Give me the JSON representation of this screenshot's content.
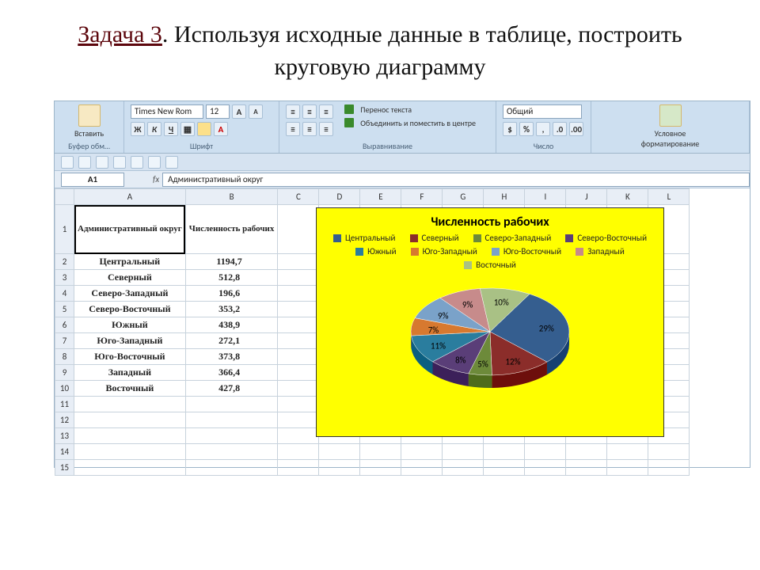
{
  "task": {
    "label": "Задача 3",
    "text": ". Используя исходные данные в таблице, построить круговую диаграмму"
  },
  "ribbon": {
    "paste": "Вставить",
    "g_clip": "Буфер обм…",
    "font_name": "Times New Rom",
    "font_size": "12",
    "bold": "Ж",
    "italic": "К",
    "underline": "Ч",
    "g_font": "Шрифт",
    "wrap": "Перенос текста",
    "merge": "Объединить и поместить в центре",
    "g_align": "Выравнивание",
    "num_fmt": "Общий",
    "g_num": "Число",
    "cond": "Условное форматирование",
    "g_styles": ""
  },
  "qat": {
    "buttons": 7
  },
  "formula_bar": {
    "name": "A1",
    "fx": "fx",
    "value": "Административный округ"
  },
  "grid": {
    "cols": [
      "A",
      "B",
      "C",
      "D",
      "E",
      "F",
      "G",
      "H",
      "I",
      "J",
      "K",
      "L"
    ],
    "rows": [
      "1",
      "2",
      "3",
      "4",
      "5",
      "6",
      "7",
      "8",
      "9",
      "10",
      "11",
      "12",
      "13",
      "14",
      "15"
    ],
    "headerA": "Административный округ",
    "headerB": "Численность рабочих",
    "data": [
      [
        "Центральный",
        "1194,7"
      ],
      [
        "Северный",
        "512,8"
      ],
      [
        "Северо-Западный",
        "196,6"
      ],
      [
        "Северо-Восточный",
        "353,2"
      ],
      [
        "Южный",
        "438,9"
      ],
      [
        "Юго-Западный",
        "272,1"
      ],
      [
        "Юго-Восточный",
        "373,8"
      ],
      [
        "Западный",
        "366,4"
      ],
      [
        "Восточный",
        "427,8"
      ]
    ]
  },
  "chart_data": {
    "type": "pie",
    "title": "Численность рабочих",
    "series": [
      {
        "name": "Центральный",
        "value": 1194.7,
        "pct": 29,
        "color": "#355e8f"
      },
      {
        "name": "Северный",
        "value": 512.8,
        "pct": 12,
        "color": "#8b2d2a"
      },
      {
        "name": "Северо-Западный",
        "value": 196.6,
        "pct": 5,
        "color": "#6d8a3a"
      },
      {
        "name": "Северо-Восточный",
        "value": 353.2,
        "pct": 8,
        "color": "#5a3e78"
      },
      {
        "name": "Южный",
        "value": 438.9,
        "pct": 11,
        "color": "#2a7d9e"
      },
      {
        "name": "Юго-Западный",
        "value": 272.1,
        "pct": 7,
        "color": "#d7792f"
      },
      {
        "name": "Юго-Восточный",
        "value": 373.8,
        "pct": 9,
        "color": "#7aa2c9"
      },
      {
        "name": "Западный",
        "value": 366.4,
        "pct": 9,
        "color": "#c78b8b"
      },
      {
        "name": "Восточный",
        "value": 427.8,
        "pct": 10,
        "color": "#a9c185"
      }
    ]
  }
}
